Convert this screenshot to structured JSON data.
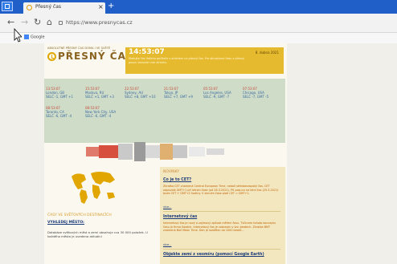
{
  "browser": {
    "tab_title": "Přesný čas",
    "tab_close": "×",
    "new_tab": "+",
    "address": "https://www.presnycas.cz",
    "bookmark": "Google",
    "nav": {
      "back": "←",
      "forward": "→",
      "reload": "↻",
      "home": "⌂"
    }
  },
  "header": {
    "tagline": "ABSOLUTNĚ PŘESNÝ ČAS DOMA I VE SVĚTĚ",
    "logo_text": "PŘESNÝ ČAS",
    "time": "14:53:07",
    "date": "8. dubna 2021",
    "note": "Sledujte čas Vašeho počítače s ohledem na přesný čas. Pro aktualizaci času a přesný posun obnovte tuto stránku."
  },
  "cities": [
    {
      "time": "13:53:07",
      "name": "London, GB",
      "zone": "SELČ -1, GMT +1"
    },
    {
      "time": "15:53:07",
      "name": "Moskva, RU",
      "zone": "SELČ +1, GMT +3"
    },
    {
      "time": "22:53:07",
      "name": "Sydney, AU",
      "zone": "SELČ +8, GMT +10"
    },
    {
      "time": "21:53:07",
      "name": "Tokyo, JP",
      "zone": "SELČ +7, GMT +9"
    },
    {
      "time": "05:53:07",
      "name": "Los Angeles, USA",
      "zone": "SELČ -9, GMT -7"
    },
    {
      "time": "07:53:07",
      "name": "Chicago, USA",
      "zone": "SELČ -7, GMT -5"
    },
    {
      "time": "08:53:07",
      "name": "Toronto, CA",
      "zone": "SELČ -6, GMT -4"
    },
    {
      "time": "08:53:07",
      "name": "New York City, USA",
      "zone": "SELČ -6, GMT -4"
    }
  ],
  "world": {
    "section_title": "ČASY VE SVĚTOVÝCH DESTINACÍCH",
    "search_link": "VYHLEDEJ MĚSTO:",
    "text": "Databáze světových měst a zemí obsahuje cca 30 000 položek. U každého města je uvedena aktuální"
  },
  "news": {
    "header": "NOVINKY",
    "items": [
      {
        "title": "Co je to CET?",
        "text": "Zkratka CET znamená Central European Time, neboli středoevropský čas. CET odpovídá GMT+1 při letním čase (od 28.3.2021). Při posunu na letní čas (25.3.2021) bude CET + GMT+2 hodiny. V zimním čase platí CET = GMT+1.",
        "more": "více..."
      },
      {
        "title": "Internetový čas",
        "text": "Internetový čas je nový a zajímavý způsob měření času. Tvůrcem tohoto konceptu času je firma Swatch. Internetový čas je zobrazen v tzv. beatech. Zkratka BMT znamená Biel Mean Time. Den je rozdělen do 1000 beatů...",
        "more": "více..."
      },
      {
        "title": "Objekte zemí z vesmíru (pomocí Google Earth)",
        "text": "",
        "more": ""
      }
    ]
  },
  "colors": {
    "titlebar": "#1f5fc7",
    "time_box": "#e6ba2e",
    "cities_bg": "#cfdcc8",
    "news_bg": "#f3e7bf",
    "logo": "#8a6320"
  }
}
